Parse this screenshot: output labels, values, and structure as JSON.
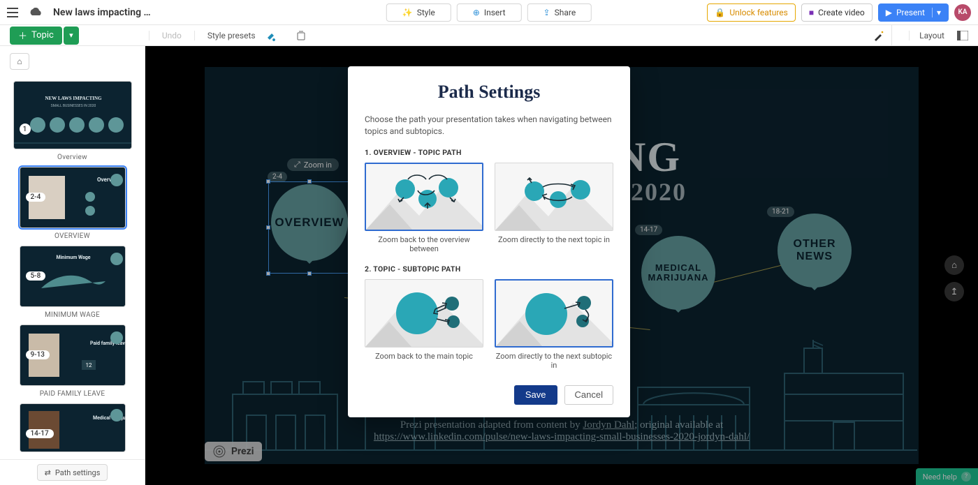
{
  "header": {
    "doc_title": "New laws impacting …",
    "style": "Style",
    "insert": "Insert",
    "share": "Share",
    "unlock": "Unlock features",
    "create_video": "Create video",
    "present": "Present",
    "avatar": "KA"
  },
  "toolbar": {
    "topic": "Topic",
    "undo": "Undo",
    "style_presets": "Style presets",
    "layout": "Layout"
  },
  "sidebar": {
    "items": [
      {
        "badge": "1",
        "label": "Overview"
      },
      {
        "badge": "2-4",
        "label": "OVERVIEW"
      },
      {
        "badge": "5-8",
        "label": "MINIMUM WAGE"
      },
      {
        "badge": "9-13",
        "label": "PAID FAMILY LEAVE"
      },
      {
        "badge": "14-17",
        "label": ""
      }
    ],
    "path_settings": "Path settings"
  },
  "canvas": {
    "title_frag": "ACTING",
    "subtitle_frag": "2020",
    "zoom_in": "Zoom in",
    "badges": {
      "overview": "2-4",
      "medical": "14-17",
      "other": "18-21"
    },
    "bubbles": {
      "overview": "OVERVIEW",
      "medical": "MEDICAL MARIJUANA",
      "other": "OTHER NEWS"
    },
    "credit_prefix": "Prezi presentation adapted from content by ",
    "credit_author": "Jordyn Dahl",
    "credit_mid": "; original available at",
    "credit_url": "https://www.linkedin.com/pulse/new-laws-impacting-small-businesses-2020-jordyn-dahl/",
    "prezi": "Prezi",
    "need_help": "Need help"
  },
  "modal": {
    "title": "Path Settings",
    "desc": "Choose the path your presentation takes when navigating between topics and subtopics.",
    "sec1": "1. OVERVIEW - TOPIC PATH",
    "sec2": "2. TOPIC - SUBTOPIC PATH",
    "opt1a": "Zoom back to the overview between",
    "opt1b": "Zoom directly to the next topic in",
    "opt2a": "Zoom back to the main topic",
    "opt2b": "Zoom directly to the next subtopic in",
    "save": "Save",
    "cancel": "Cancel"
  }
}
